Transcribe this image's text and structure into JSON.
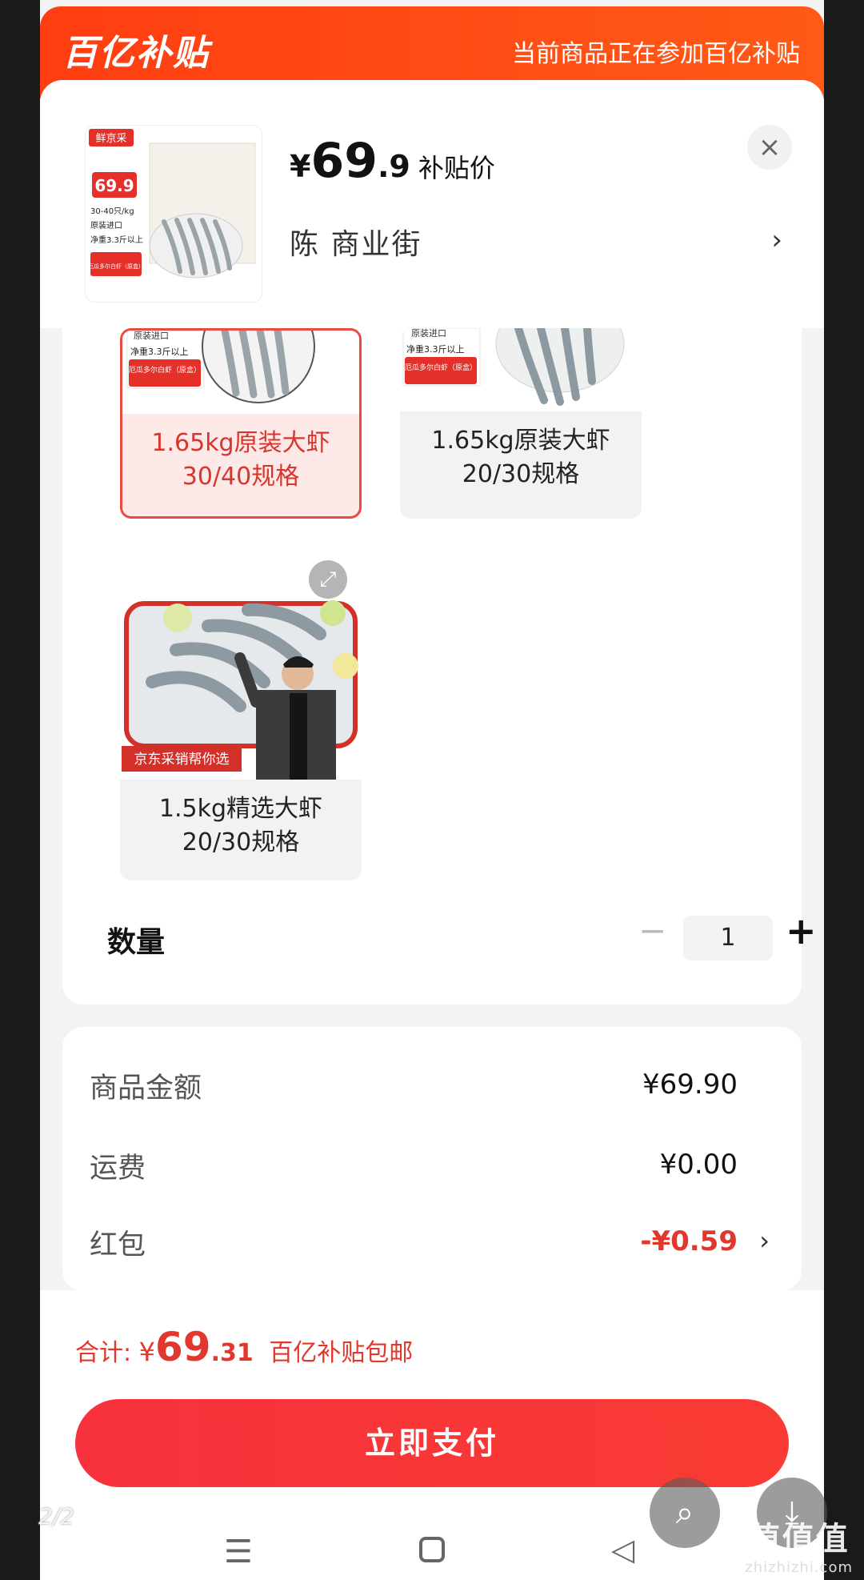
{
  "banner": {
    "logo": "百亿补贴",
    "note": "当前商品正在参加百亿补贴"
  },
  "product": {
    "thumb_brand": "鲜京采",
    "thumb_price": "69.9",
    "thumb_lines": [
      "30-40只/kg",
      "原装进口",
      "净重3.3斤以上"
    ],
    "thumb_badge": "厄瓜多尔白虾（原盒）",
    "price_yen": "¥",
    "price_int": "69",
    "price_dec": ".9",
    "price_tag": "补贴价",
    "address": "陈  商业街",
    "close": "×"
  },
  "specs": [
    {
      "label_line1": "1.65kg原装大虾",
      "label_line2": "30/40规格",
      "img_lines": [
        "原装进口",
        "净重3.3斤以上",
        "厄瓜多尔白虾（原盒）"
      ],
      "selected": true
    },
    {
      "label_line1": "1.65kg原装大虾",
      "label_line2": "20/30规格",
      "img_lines": [
        "原装进口",
        "净重3.3斤以上",
        "厄瓜多尔白虾（原盒）"
      ],
      "selected": false
    },
    {
      "label_line1": "1.5kg精选大虾",
      "label_line2": "20/30规格",
      "img_caption": "京东采销帮你选",
      "selected": false
    }
  ],
  "quantity": {
    "label": "数量",
    "minus": "−",
    "value": "1",
    "plus": "+"
  },
  "breakdown": {
    "goods_label": "商品金额",
    "goods_value": "¥69.90",
    "shipping_label": "运费",
    "shipping_value": "¥0.00",
    "coupon_label": "红包",
    "coupon_value": "-¥0.59"
  },
  "footer": {
    "total_label": "合计:",
    "total_yen": "¥",
    "total_int": "69",
    "total_dec": ".31",
    "total_note": "百亿补贴包邮",
    "pay_button": "立即支付"
  },
  "overlay": {
    "page_indicator": "2/2",
    "watermark_logo": "值值值",
    "watermark_url": "zhizhizhi.com"
  },
  "colors": {
    "brand_orange": "#ff4a14",
    "accent_red": "#e2372c",
    "pay_button": "#f7323d"
  }
}
